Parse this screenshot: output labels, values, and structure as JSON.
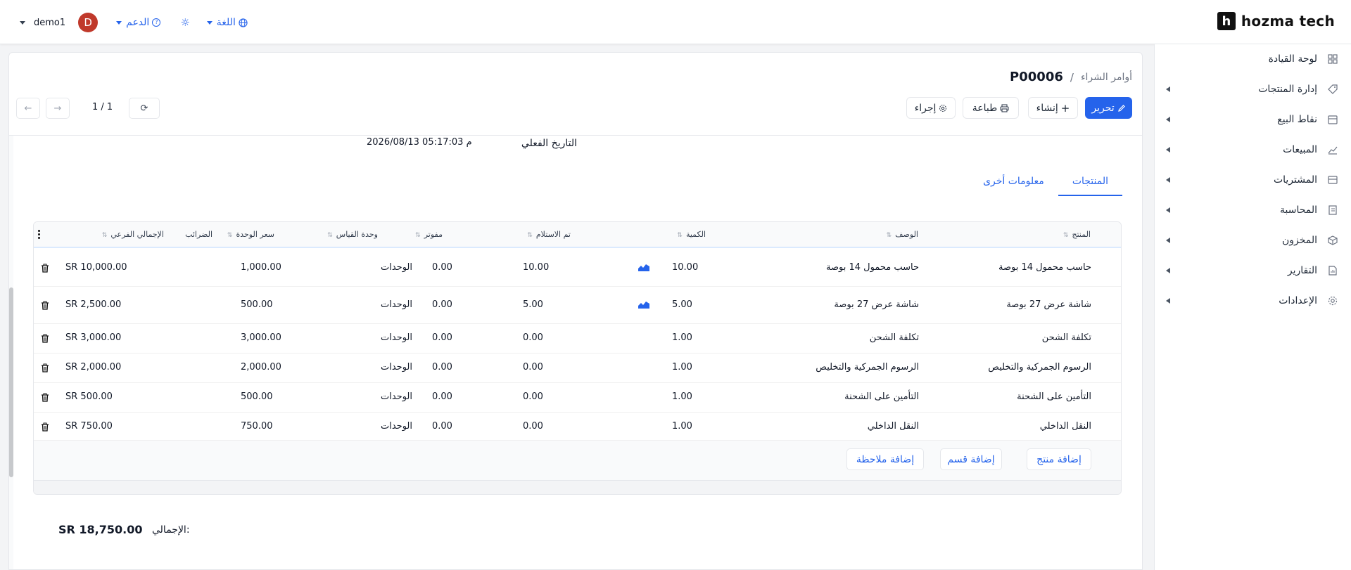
{
  "topbar": {
    "user": "demo1",
    "avatar_letter": "D",
    "support_label": "الدعم",
    "language_label": "اللغة",
    "brand_letter": "h",
    "brand_name": "hozma tech"
  },
  "sidebar": {
    "items": [
      {
        "label": "لوحة القيادة",
        "icon": "dashboard-icon",
        "expandable": false
      },
      {
        "label": "إدارة المنتجات",
        "icon": "tag-icon",
        "expandable": true
      },
      {
        "label": "نقاط البيع",
        "icon": "store-icon",
        "expandable": true
      },
      {
        "label": "المبيعات",
        "icon": "chart-line-icon",
        "expandable": true
      },
      {
        "label": "المشتريات",
        "icon": "wallet-icon",
        "expandable": true
      },
      {
        "label": "المحاسبة",
        "icon": "ledger-icon",
        "expandable": true
      },
      {
        "label": "المخزون",
        "icon": "box-icon",
        "expandable": true
      },
      {
        "label": "التقارير",
        "icon": "report-icon",
        "expandable": true
      },
      {
        "label": "الإعدادات",
        "icon": "gear-icon",
        "expandable": true
      }
    ]
  },
  "header": {
    "breadcrumb_parent": "أوامر الشراء",
    "breadcrumb_sep": "/",
    "record_id": "P00006"
  },
  "toolbar": {
    "edit_label": "تحرير",
    "create_label": "إنشاء",
    "print_label": "طباعة",
    "action_label": "إجراء",
    "pager": "1 / 1"
  },
  "form": {
    "actual_date_label": "التاريخ الفعلي",
    "actual_date_value": "2026/08/13 05:17:03 م"
  },
  "tabs": [
    {
      "label": "المنتجات",
      "active": true
    },
    {
      "label": "معلومات أخرى",
      "active": false
    }
  ],
  "table": {
    "columns": {
      "product": "المنتج",
      "description": "الوصف",
      "quantity": "الكمية",
      "received": "تم الاستلام",
      "billed": "مفوتر",
      "uom": "وحدة القياس",
      "unit_price": "سعر الوحدة",
      "taxes": "الضرائب",
      "subtotal": "الإجمالي الفرعي"
    },
    "rows": [
      {
        "product": "حاسب محمول 14 بوصة",
        "description": "حاسب محمول 14 بوصة",
        "quantity": "10.00",
        "received": "10.00",
        "billed": "0.00",
        "uom": "الوحدات",
        "unit_price": "1,000.00",
        "taxes": "",
        "subtotal": "SR 10,000.00",
        "forecast": true
      },
      {
        "product": "شاشة عرض 27 بوصة",
        "description": "شاشة عرض 27 بوصة",
        "quantity": "5.00",
        "received": "5.00",
        "billed": "0.00",
        "uom": "الوحدات",
        "unit_price": "500.00",
        "taxes": "",
        "subtotal": "SR 2,500.00",
        "forecast": true
      },
      {
        "product": "تكلفة الشحن",
        "description": "تكلفة الشحن",
        "quantity": "1.00",
        "received": "0.00",
        "billed": "0.00",
        "uom": "الوحدات",
        "unit_price": "3,000.00",
        "taxes": "",
        "subtotal": "SR 3,000.00",
        "forecast": false
      },
      {
        "product": "الرسوم الجمركية والتخليص",
        "description": "الرسوم الجمركية والتخليص",
        "quantity": "1.00",
        "received": "0.00",
        "billed": "0.00",
        "uom": "الوحدات",
        "unit_price": "2,000.00",
        "taxes": "",
        "subtotal": "SR 2,000.00",
        "forecast": false
      },
      {
        "product": "التأمين على الشحنة",
        "description": "التأمين على الشحنة",
        "quantity": "1.00",
        "received": "0.00",
        "billed": "0.00",
        "uom": "الوحدات",
        "unit_price": "500.00",
        "taxes": "",
        "subtotal": "SR 500.00",
        "forecast": false
      },
      {
        "product": "النقل الداخلي",
        "description": "النقل الداخلي",
        "quantity": "1.00",
        "received": "0.00",
        "billed": "0.00",
        "uom": "الوحدات",
        "unit_price": "750.00",
        "taxes": "",
        "subtotal": "SR 750.00",
        "forecast": false
      }
    ],
    "add_product": "إضافة منتج",
    "add_section": "إضافة قسم",
    "add_note": "إضافة ملاحظة"
  },
  "totals": {
    "label": "الإجمالي:",
    "value": "SR 18,750.00"
  },
  "colors": {
    "accent": "#2563eb",
    "avatar": "#c0392b"
  }
}
